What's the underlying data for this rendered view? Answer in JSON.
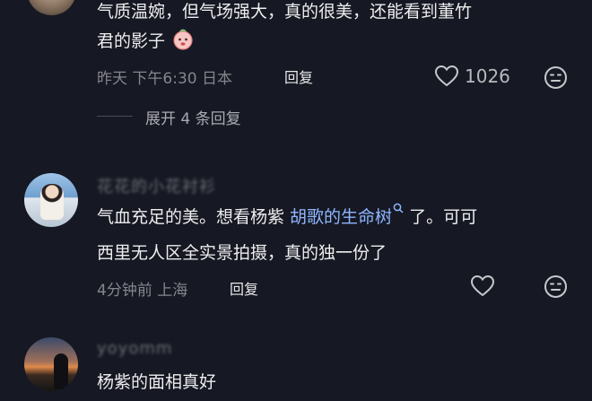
{
  "comments": [
    {
      "username": "",
      "text_line1": "气质温婉，但气场强大，真的很美，还能看到董竹",
      "text_line2": "君的影子",
      "emoji": "peach-face-icon",
      "meta": "昨天 下午6:30 日本",
      "reply_label": "回复",
      "like_count": "1026",
      "expand_label": "展开 4 条回复"
    },
    {
      "username": "花花的小花衬衫",
      "text_line1_prefix": "气血充足的美。想看杨紫 ",
      "text_line1_link": "胡歌的生命树",
      "text_line1_suffix": " 了。可可",
      "text_line2": "西里无人区全实景拍摄，真的独一份了",
      "meta": "4分钟前 上海",
      "reply_label": "回复"
    },
    {
      "username": "yoyomm",
      "text_line1": "杨紫的面相真好"
    }
  ],
  "colors": {
    "background": "#161823",
    "text": "#eeeeef",
    "meta": "#85868c",
    "link": "#8fb6ff"
  }
}
